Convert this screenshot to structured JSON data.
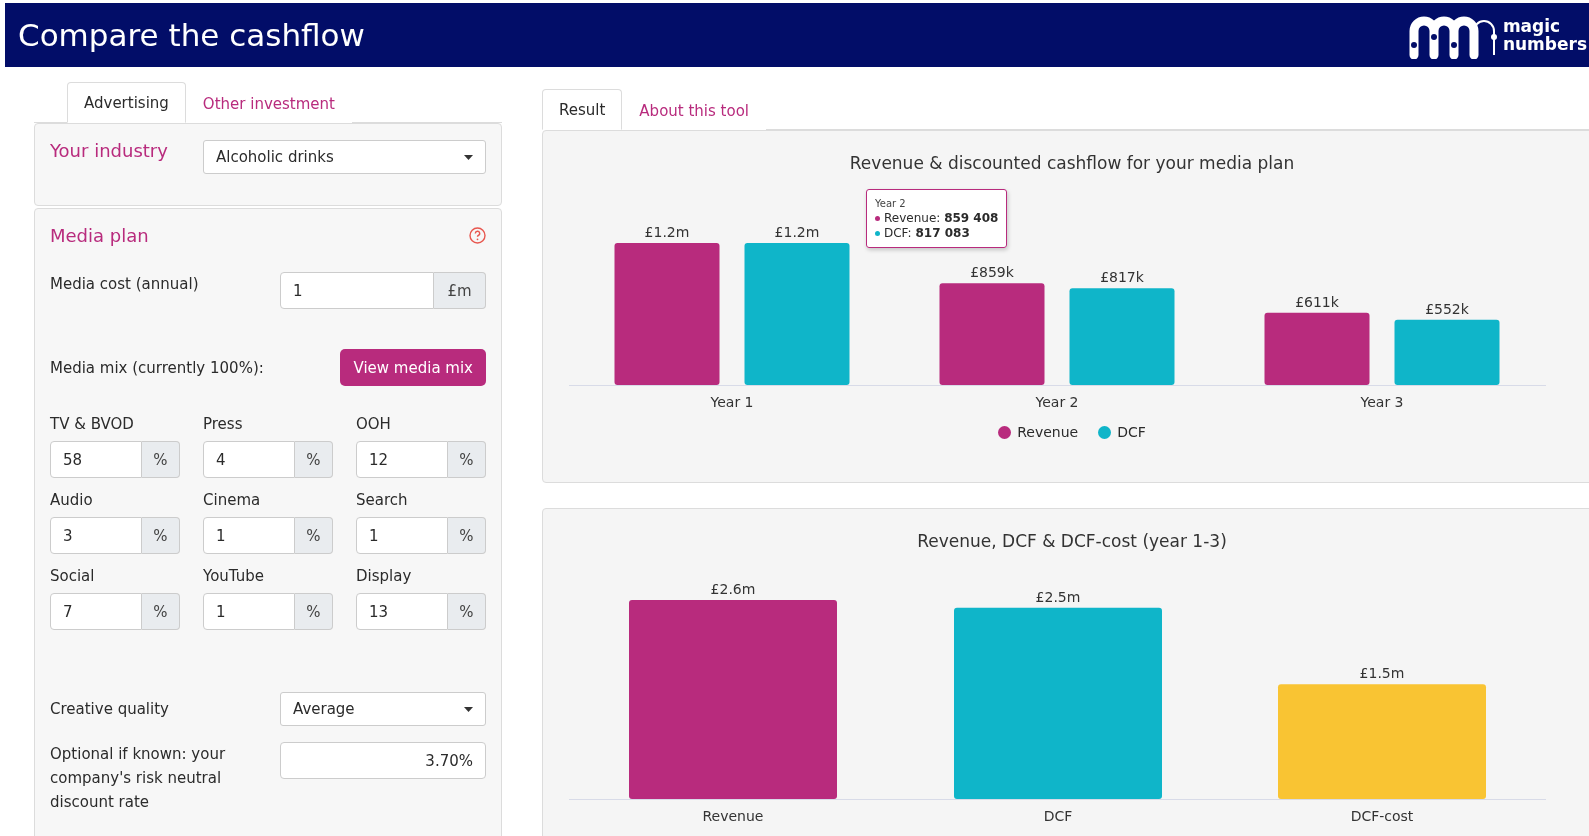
{
  "header": {
    "title": "Compare the cashflow",
    "logo": {
      "line_1": "magic",
      "line_2": "numbers"
    }
  },
  "left_tabs": [
    {
      "label": "Advertising",
      "selected": true
    },
    {
      "label": "Other investment",
      "selected": false
    }
  ],
  "industry": {
    "label": "Your industry",
    "value": "Alcoholic drinks"
  },
  "media_plan": {
    "title": "Media plan",
    "cost": {
      "label": "Media cost (annual)",
      "value": "1",
      "unit": "£m"
    },
    "mix": {
      "label": "Media mix (currently 100%):",
      "button": "View media mix"
    },
    "channels": [
      {
        "name": "TV & BVOD",
        "value": "58",
        "unit": "%"
      },
      {
        "name": "Press",
        "value": "4",
        "unit": "%"
      },
      {
        "name": "OOH",
        "value": "12",
        "unit": "%"
      },
      {
        "name": "Audio",
        "value": "3",
        "unit": "%"
      },
      {
        "name": "Cinema",
        "value": "1",
        "unit": "%"
      },
      {
        "name": "Search",
        "value": "1",
        "unit": "%"
      },
      {
        "name": "Social",
        "value": "7",
        "unit": "%"
      },
      {
        "name": "YouTube",
        "value": "1",
        "unit": "%"
      },
      {
        "name": "Display",
        "value": "13",
        "unit": "%"
      }
    ],
    "creative": {
      "label": "Creative quality",
      "value": "Average"
    },
    "discount": {
      "label": "Optional if known: your company's risk neutral discount rate",
      "value": "3.70%"
    }
  },
  "right_tabs": [
    {
      "label": "Result",
      "selected": true
    },
    {
      "label": "About this tool",
      "selected": false
    }
  ],
  "charts": [
    {
      "title": "Revenue & discounted cashflow for your media plan",
      "chart_data": {
        "type": "bar",
        "categories": [
          "Year 1",
          "Year 2",
          "Year 3"
        ],
        "series": [
          {
            "name": "Revenue",
            "color": "#b82b7d",
            "values": [
              1200000,
              859408,
              611000
            ],
            "value_labels": [
              "£1.2m",
              "£859k",
              "£611k"
            ]
          },
          {
            "name": "DCF",
            "color": "#0fb5c9",
            "values": [
              1200000,
              817083,
              552000
            ],
            "value_labels": [
              "£1.2m",
              "£817k",
              "£552k"
            ]
          }
        ]
      },
      "tooltip": {
        "title": "Year 2",
        "rows": [
          {
            "label": "Revenue: ",
            "value": "859 408",
            "color": "#b82b7d"
          },
          {
            "label": "DCF: ",
            "value": "817 083",
            "color": "#0fb5c9"
          }
        ]
      }
    },
    {
      "title": "Revenue, DCF & DCF-cost (year 1-3)",
      "chart_data": {
        "type": "bar",
        "categories": [
          "Revenue",
          "DCF",
          "DCF-cost"
        ],
        "values": [
          2600000,
          2500000,
          1500000
        ],
        "colors": [
          "#b82b7d",
          "#0fb5c9",
          "#f9c433"
        ],
        "value_labels": [
          "£2.6m",
          "£2.5m",
          "£1.5m"
        ]
      }
    }
  ]
}
